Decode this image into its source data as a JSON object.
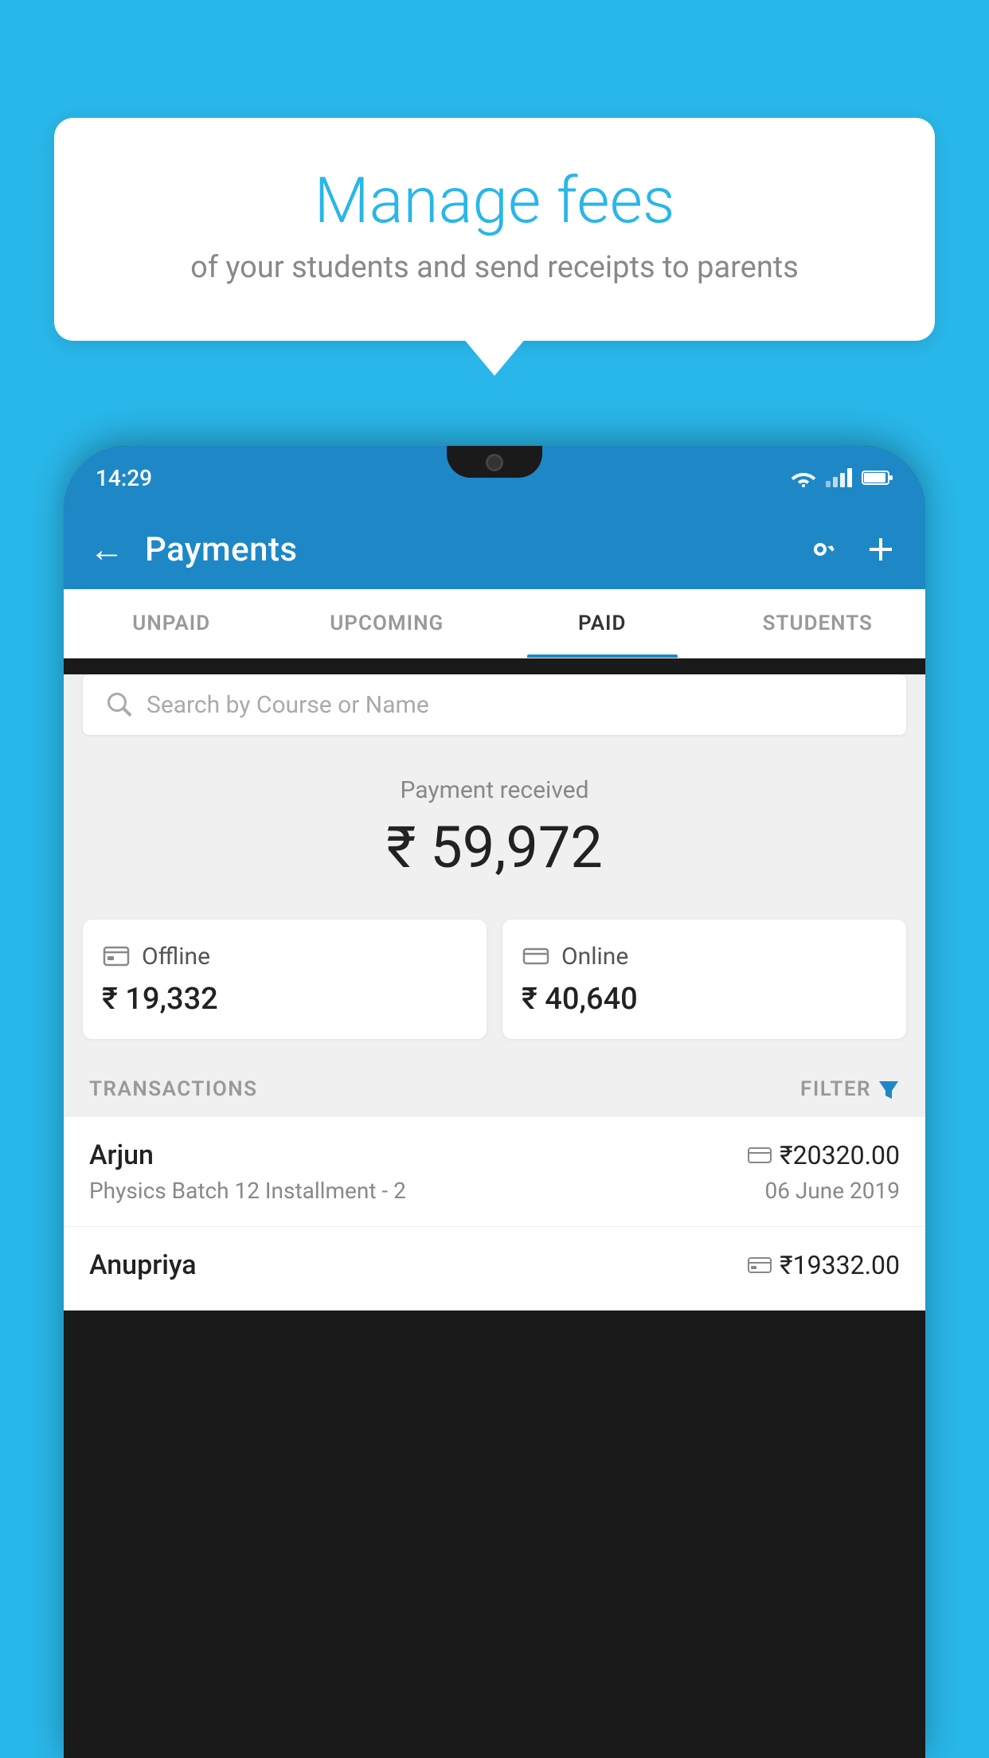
{
  "background_color": "#29b6e8",
  "bubble": {
    "title": "Manage fees",
    "subtitle": "of your students and send receipts to parents"
  },
  "status_bar": {
    "time": "14:29"
  },
  "app_bar": {
    "title": "Payments",
    "back_label": "←"
  },
  "tabs": [
    {
      "label": "UNPAID",
      "active": false
    },
    {
      "label": "UPCOMING",
      "active": false
    },
    {
      "label": "PAID",
      "active": true
    },
    {
      "label": "STUDENTS",
      "active": false
    }
  ],
  "search": {
    "placeholder": "Search by Course or Name"
  },
  "payment_received": {
    "label": "Payment received",
    "amount": "₹ 59,972",
    "offline": {
      "type": "Offline",
      "amount": "₹ 19,332"
    },
    "online": {
      "type": "Online",
      "amount": "₹ 40,640"
    }
  },
  "transactions": {
    "header_label": "TRANSACTIONS",
    "filter_label": "FILTER",
    "items": [
      {
        "name": "Arjun",
        "course": "Physics Batch 12 Installment - 2",
        "amount": "₹20320.00",
        "date": "06 June 2019",
        "payment_type": "online"
      },
      {
        "name": "Anupriya",
        "course": "",
        "amount": "₹19332.00",
        "date": "",
        "payment_type": "offline"
      }
    ]
  }
}
